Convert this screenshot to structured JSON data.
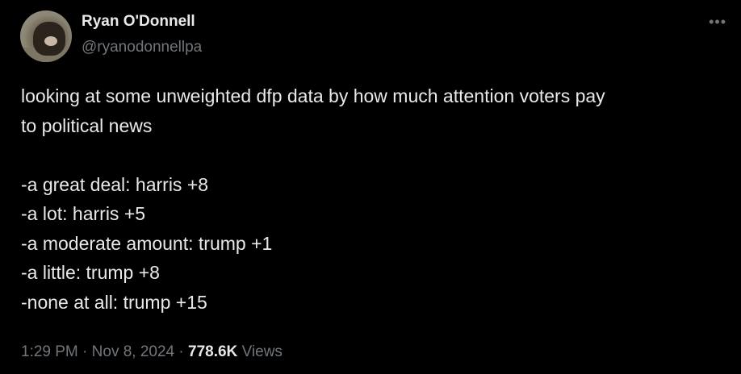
{
  "author": {
    "display_name": "Ryan O'Donnell",
    "handle": "@ryanodonnellpa"
  },
  "more_icon": "•••",
  "tweet": {
    "lines": [
      "looking at some unweighted dfp data by how much attention voters pay",
      "to political news",
      "",
      "-a great deal: harris +8",
      "-a lot: harris +5",
      "-a moderate amount: trump +1",
      "-a little: trump +8",
      "-none at all: trump +15"
    ]
  },
  "meta": {
    "time": "1:29 PM",
    "separator": "·",
    "date": "Nov 8, 2024",
    "views_count": "778.6K",
    "views_label": "Views"
  }
}
